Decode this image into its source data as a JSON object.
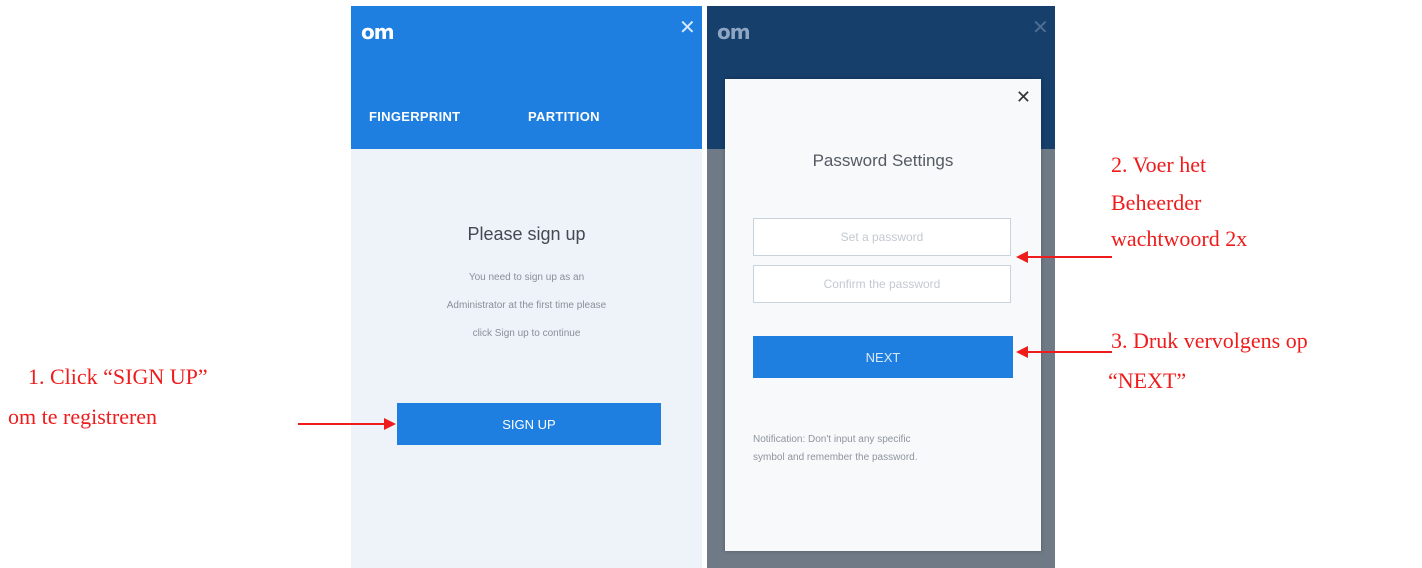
{
  "signup_screen": {
    "logo": "om",
    "close_glyph": "✕",
    "tabs": [
      "FINGERPRINT",
      "PARTITION"
    ],
    "title": "Please sign up",
    "description_lines": [
      "You need to sign up as an",
      "Administrator at the first time please",
      "click Sign up to continue"
    ],
    "signup_button": "SIGN UP"
  },
  "password_screen": {
    "logo": "om",
    "close_glyph": "✕",
    "modal": {
      "close_glyph": "✕",
      "title": "Password Settings",
      "set_password_placeholder": "Set a password",
      "confirm_password_placeholder": "Confirm the password",
      "next_button": "NEXT",
      "notification_lines": [
        "Notification: Don't input any specific",
        "symbol and remember the password."
      ]
    }
  },
  "annotations": {
    "step1_line1": "1. Click “SIGN UP”",
    "step1_line2": "om te registreren",
    "step2_line1": "2.   Voer   het",
    "step2_line2": "Beheerder",
    "step2_line3": "wachtwoord 2x",
    "step3_line1": "3. Druk  vervolgens op",
    "step3_line2": "“NEXT”"
  },
  "colors": {
    "brand_blue": "#1e7fe0",
    "dark_blue": "#163f6b",
    "annotation_red": "#ee1c1c"
  }
}
